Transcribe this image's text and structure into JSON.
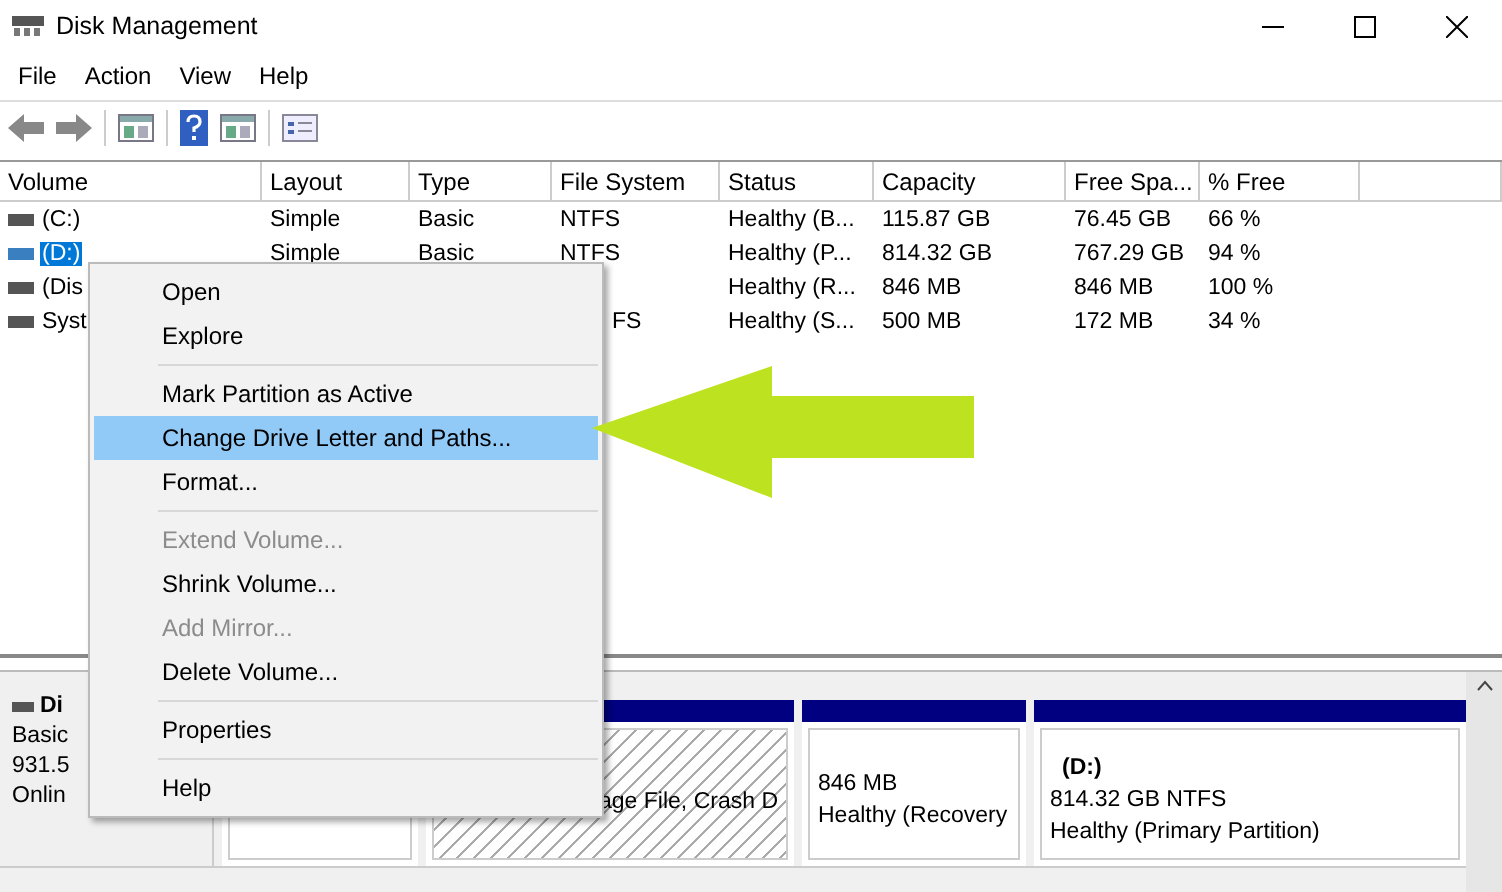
{
  "window": {
    "title": "Disk Management"
  },
  "menu_bar": [
    "File",
    "Action",
    "View",
    "Help"
  ],
  "table": {
    "columns": [
      "Volume",
      "Layout",
      "Type",
      "File System",
      "Status",
      "Capacity",
      "Free Spa...",
      "% Free"
    ],
    "rows": [
      {
        "selected": false,
        "cells": [
          "(C:)",
          "Simple",
          "Basic",
          "NTFS",
          "Healthy (B...",
          "115.87 GB",
          "76.45 GB",
          "66 %"
        ]
      },
      {
        "selected": true,
        "cells": [
          "(D:)",
          "Simple",
          "Basic",
          "NTFS",
          "Healthy (P...",
          "814.32 GB",
          "767.29 GB",
          "94 %"
        ]
      },
      {
        "selected": false,
        "cells": [
          "(Dis",
          "",
          "",
          "",
          "Healthy (R...",
          "846 MB",
          "846 MB",
          "100 %"
        ]
      },
      {
        "selected": false,
        "cells": [
          "Syst",
          "",
          "",
          "FS",
          "Healthy (S...",
          "500 MB",
          "172 MB",
          "34 %"
        ]
      }
    ]
  },
  "disk": {
    "name": "Di",
    "lines": [
      "Basic",
      "931.5",
      "Onlin"
    ],
    "partitions": [
      {
        "selected": false
      },
      {
        "selected": true,
        "lines": [
          "age File, Crash D"
        ]
      },
      {
        "selected": false,
        "lines": [
          "846 MB",
          "Healthy (Recovery"
        ]
      },
      {
        "selected": false,
        "title": "(D:)",
        "lines": [
          "814.32 GB NTFS",
          "Healthy (Primary Partition)"
        ]
      }
    ]
  },
  "context_menu": {
    "groups": [
      [
        {
          "label": "Open",
          "disabled": false,
          "selected": false
        },
        {
          "label": "Explore",
          "disabled": false,
          "selected": false
        }
      ],
      [
        {
          "label": "Mark Partition as Active",
          "disabled": false,
          "selected": false
        },
        {
          "label": "Change Drive Letter and Paths...",
          "disabled": false,
          "selected": true
        },
        {
          "label": "Format...",
          "disabled": false,
          "selected": false
        }
      ],
      [
        {
          "label": "Extend Volume...",
          "disabled": true,
          "selected": false
        },
        {
          "label": "Shrink Volume...",
          "disabled": false,
          "selected": false
        },
        {
          "label": "Add Mirror...",
          "disabled": true,
          "selected": false
        },
        {
          "label": "Delete Volume...",
          "disabled": false,
          "selected": false
        }
      ],
      [
        {
          "label": "Properties",
          "disabled": false,
          "selected": false
        }
      ],
      [
        {
          "label": "Help",
          "disabled": false,
          "selected": false
        }
      ]
    ]
  }
}
